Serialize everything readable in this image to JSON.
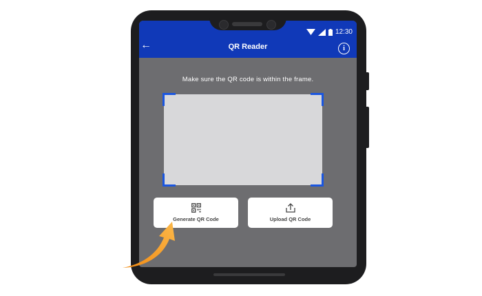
{
  "status_bar": {
    "time": "12:30"
  },
  "app_bar": {
    "title": "QR Reader"
  },
  "scanner": {
    "instruction": "Make sure the QR code is within the frame."
  },
  "actions": {
    "generate_label": "Generate QR Code",
    "upload_label": "Upload QR Code"
  },
  "colors": {
    "app_bar": "#1039b8",
    "screen_bg": "#6d6d70",
    "frame_corner": "#1a56e0",
    "arrow": "#f5901e"
  }
}
